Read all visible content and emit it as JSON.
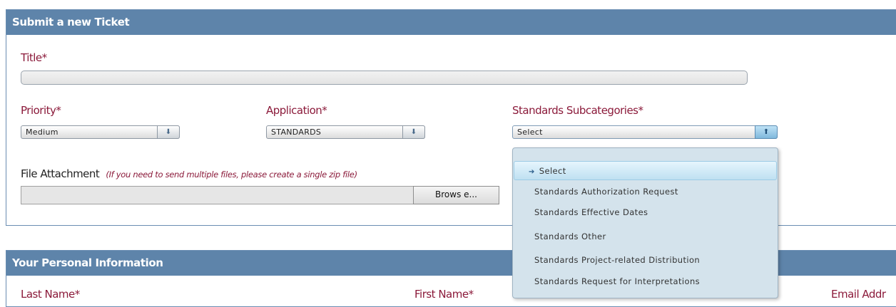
{
  "ticket_form": {
    "header": "Submit a new Ticket",
    "title_label": "Title*",
    "title_value": "",
    "priority": {
      "label": "Priority*",
      "value": "Medium"
    },
    "application": {
      "label": "Application*",
      "value": "STANDARDS"
    },
    "subcategory": {
      "label": "Standards Subcategories*",
      "value": "Select",
      "options": [
        "Select",
        "Standards Authorization Request",
        "Standards Effective Dates",
        "Standards Other",
        "Standards Project-related Distribution",
        "Standards Request for Interpretations"
      ],
      "selected_index": 0
    },
    "attachment": {
      "label": "File Attachment",
      "hint": "(If you need to send multiple files, please create a single zip file)",
      "browse_label": "Brows e..."
    }
  },
  "personal_info": {
    "header": "Your Personal Information",
    "last_name_label": "Last Name*",
    "first_name_label": "First Name*",
    "email_label": "Email Addr"
  },
  "colors": {
    "header_bg": "#5e84aa",
    "label_color": "#8b1a3a",
    "dropdown_bg": "#d4e3ec"
  },
  "icons": {
    "dropdown_arrow": "arrow-down-icon",
    "dropdown_arrow_active": "arrow-up-icon",
    "selected_marker": "arrow-right-icon"
  }
}
